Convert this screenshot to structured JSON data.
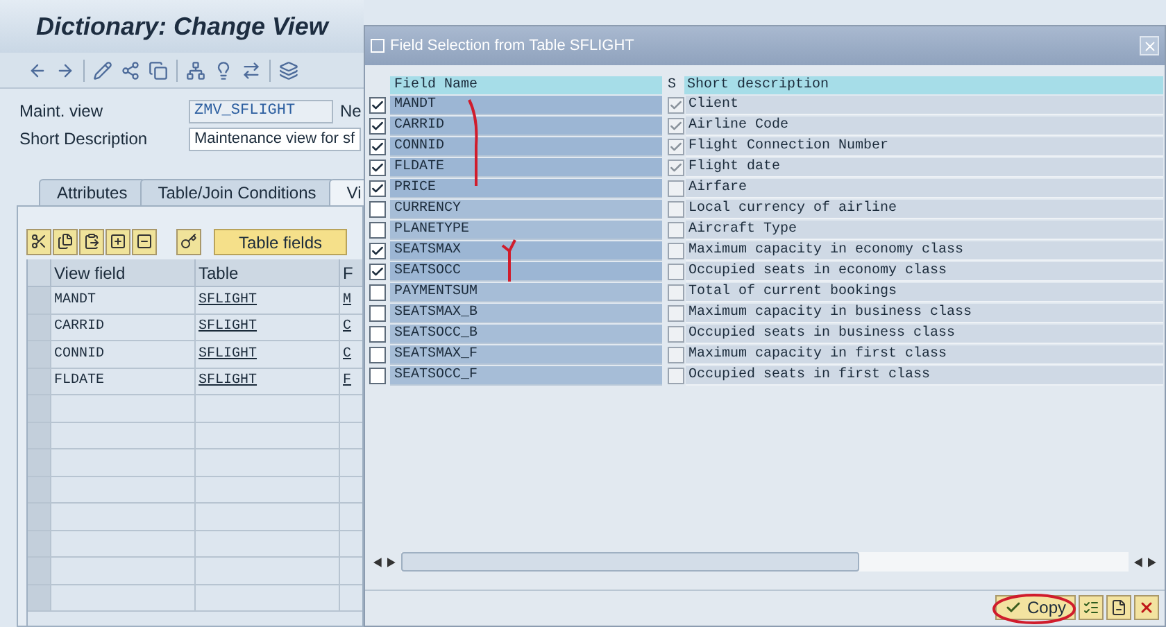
{
  "main": {
    "title": "Dictionary: Change View",
    "fields": [
      {
        "label": "Maint. view",
        "value": "ZMV_SFLIGHT",
        "after": "Ne"
      },
      {
        "label": "Short Description",
        "value": "Maintenance view for sf"
      }
    ],
    "tabs": [
      {
        "label": "Attributes",
        "selected": false
      },
      {
        "label": "Table/Join Conditions",
        "selected": false
      },
      {
        "label": "Vi",
        "selected": true
      }
    ],
    "table_button": "Table fields",
    "table": {
      "columns": [
        "View field",
        "Table",
        "F"
      ],
      "rows": [
        [
          "MANDT",
          "SFLIGHT",
          "M"
        ],
        [
          "CARRID",
          "SFLIGHT",
          "C"
        ],
        [
          "CONNID",
          "SFLIGHT",
          "C"
        ],
        [
          "FLDATE",
          "SFLIGHT",
          "F"
        ]
      ]
    }
  },
  "dialog": {
    "title": "Field Selection from Table SFLIGHT",
    "columns": [
      "Field Name",
      "S",
      "Short description"
    ],
    "rows": [
      {
        "field": "MANDT",
        "selected": true,
        "key": true,
        "description": "Client"
      },
      {
        "field": "CARRID",
        "selected": true,
        "key": true,
        "description": "Airline Code"
      },
      {
        "field": "CONNID",
        "selected": true,
        "key": true,
        "description": "Flight Connection Number"
      },
      {
        "field": "FLDATE",
        "selected": true,
        "key": true,
        "description": "Flight date"
      },
      {
        "field": "PRICE",
        "selected": true,
        "key": false,
        "description": "Airfare"
      },
      {
        "field": "CURRENCY",
        "selected": false,
        "key": false,
        "description": "Local currency of airline"
      },
      {
        "field": "PLANETYPE",
        "selected": false,
        "key": false,
        "description": "Aircraft Type"
      },
      {
        "field": "SEATSMAX",
        "selected": true,
        "key": false,
        "description": "Maximum capacity in economy class"
      },
      {
        "field": "SEATSOCC",
        "selected": true,
        "key": false,
        "description": "Occupied seats in economy class"
      },
      {
        "field": "PAYMENTSUM",
        "selected": false,
        "key": false,
        "description": "Total of current bookings"
      },
      {
        "field": "SEATSMAX_B",
        "selected": false,
        "key": false,
        "description": "Maximum capacity in business class"
      },
      {
        "field": "SEATSOCC_B",
        "selected": false,
        "key": false,
        "description": "Occupied seats in business class"
      },
      {
        "field": "SEATSMAX_F",
        "selected": false,
        "key": false,
        "description": "Maximum capacity in first class"
      },
      {
        "field": "SEATSOCC_F",
        "selected": false,
        "key": false,
        "description": "Occupied seats in first class"
      }
    ],
    "buttons": [
      {
        "kind": "copy",
        "label": "Copy"
      },
      {
        "kind": "select-all"
      },
      {
        "kind": "deselect"
      },
      {
        "kind": "cancel"
      }
    ]
  }
}
